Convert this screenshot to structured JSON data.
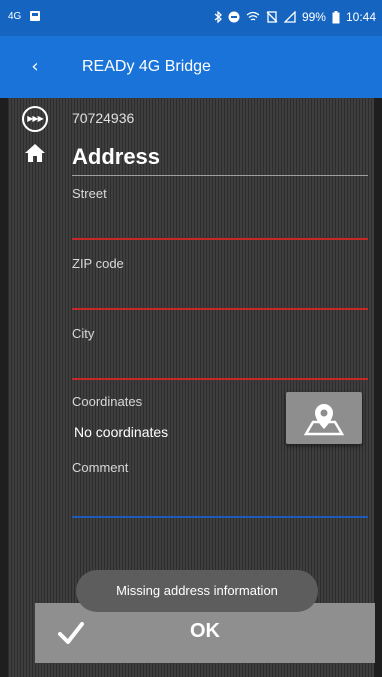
{
  "status_bar": {
    "signal_text": "4G",
    "battery": "99%",
    "time": "10:44"
  },
  "app_bar": {
    "back_icon": "back-arrow-icon",
    "title": "READy 4G Bridge"
  },
  "device": {
    "icon": "bridge-device-icon",
    "serial": "70724936"
  },
  "section": {
    "icon": "home-icon",
    "title": "Address"
  },
  "fields": {
    "street": {
      "label": "Street",
      "value": ""
    },
    "zip": {
      "label": "ZIP code",
      "value": ""
    },
    "city": {
      "label": "City",
      "value": ""
    },
    "coordinates": {
      "label": "Coordinates",
      "value": "No coordinates"
    },
    "comment": {
      "label": "Comment",
      "value": ""
    }
  },
  "map_button_icon": "map-pin-icon",
  "toast": "Missing address information",
  "ok_button": {
    "label": "OK",
    "icon": "check-icon"
  },
  "colors": {
    "app_bar": "#1a73d9",
    "status_bar": "#1565c0",
    "error_underline": "#c62828",
    "focus_underline": "#1e5bb8"
  }
}
